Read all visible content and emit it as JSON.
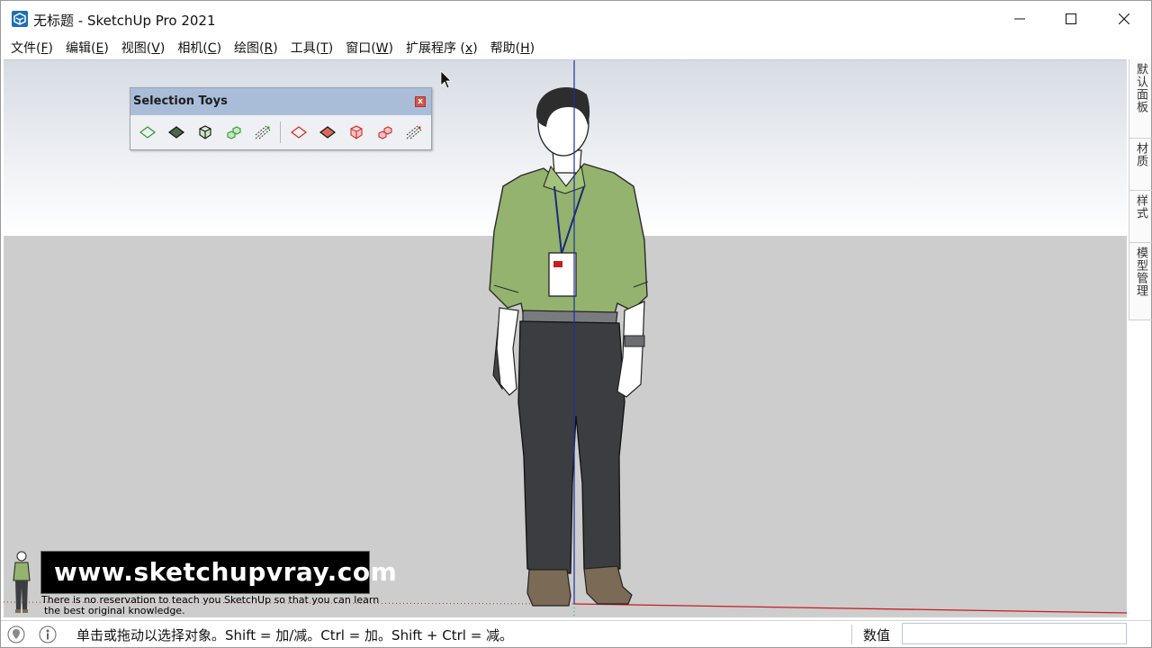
{
  "window": {
    "title": "无标题 - SketchUp Pro 2021",
    "app_icon": "sketchup-logo-icon",
    "controls": [
      "minimize-icon",
      "maximize-icon",
      "close-icon"
    ]
  },
  "menu": [
    {
      "label": "文件(",
      "mnemonic": "F",
      "suffix": ")"
    },
    {
      "label": "编辑(",
      "mnemonic": "E",
      "suffix": ")"
    },
    {
      "label": "视图(",
      "mnemonic": "V",
      "suffix": ")"
    },
    {
      "label": "相机(",
      "mnemonic": "C",
      "suffix": ")"
    },
    {
      "label": "绘图(",
      "mnemonic": "R",
      "suffix": ")"
    },
    {
      "label": "工具(",
      "mnemonic": "T",
      "suffix": ")"
    },
    {
      "label": "窗口(",
      "mnemonic": "W",
      "suffix": ")"
    },
    {
      "label": "扩展程序 (",
      "mnemonic": "x",
      "suffix": ")"
    },
    {
      "label": "帮助(",
      "mnemonic": "H",
      "suffix": ")"
    }
  ],
  "toolbar": {
    "title": "Selection Toys",
    "close_glyph": "x",
    "buttons": [
      {
        "icon": "select-faces-green-icon",
        "color": "#2e9a3a"
      },
      {
        "icon": "select-faces-filled-green-icon",
        "color": "#2e9a3a"
      },
      {
        "icon": "select-groups-green-icon",
        "color": "#2e9a3a"
      },
      {
        "icon": "select-components-green-icon",
        "color": "#2e9a3a"
      },
      {
        "icon": "select-edges-green-icon",
        "color": "#2e9a3a"
      },
      {
        "icon": "deselect-faces-red-icon",
        "color": "#d12b2b"
      },
      {
        "icon": "deselect-faces-filled-red-icon",
        "color": "#d12b2b"
      },
      {
        "icon": "deselect-groups-red-icon",
        "color": "#d12b2b"
      },
      {
        "icon": "deselect-components-red-icon",
        "color": "#d12b2b"
      },
      {
        "icon": "deselect-edges-red-icon",
        "color": "#d12b2b"
      }
    ]
  },
  "side_tray": {
    "tabs": [
      "默认面板",
      "材质",
      "样式",
      "模型管理"
    ]
  },
  "watermark": {
    "url": "www.sketchupvray.com",
    "line1": "There is no reservation to teach you SketchUp so that you can learn",
    "line2": "the best original knowledge."
  },
  "status": {
    "icons": [
      "geo-location-icon",
      "info-icon"
    ],
    "hint": "单击或拖动以选择对象。Shift = 加/减。Ctrl = 加。Shift + Ctrl = 减。",
    "measurements_label": "数值",
    "measurements_value": ""
  },
  "colors": {
    "sky_top": "#d7dce4",
    "ground": "#cdcdcd",
    "blue_axis": "#1e2ea0",
    "red_axis": "#c81e1e",
    "green_axis": "#2e9a3a",
    "shirt": "#93b36e",
    "pants": "#3c3d40"
  }
}
